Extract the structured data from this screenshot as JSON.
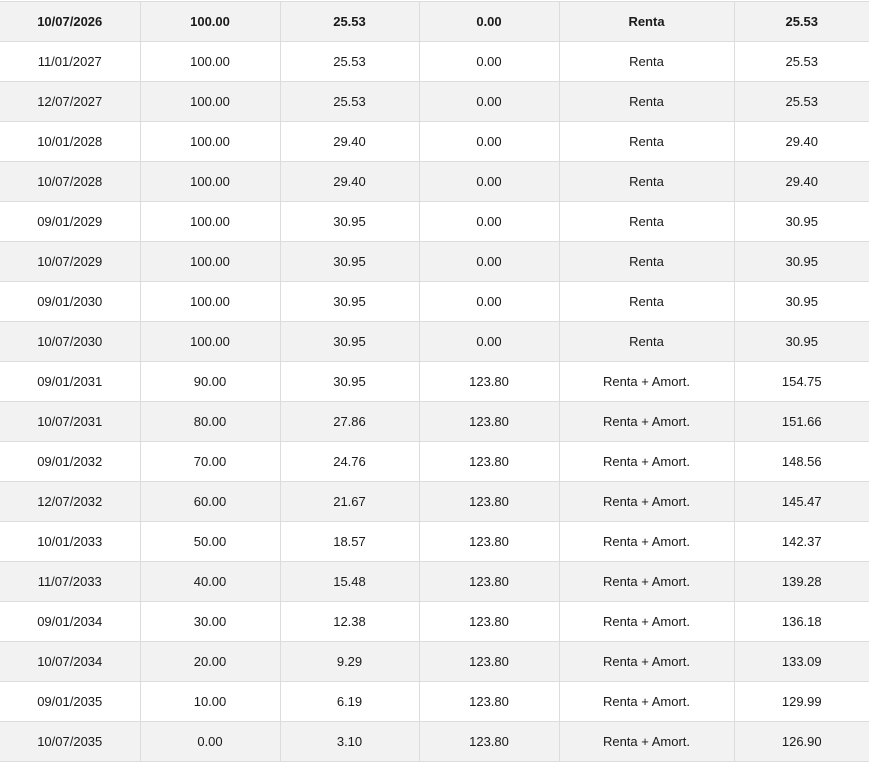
{
  "table": {
    "rows": [
      {
        "fecha": "10/07/2026",
        "valor_residual": "100.00",
        "interes": "25.53",
        "amortizacion": "0.00",
        "tipo": "Renta",
        "total": "25.53",
        "highlight": true
      },
      {
        "fecha": "11/01/2027",
        "valor_residual": "100.00",
        "interes": "25.53",
        "amortizacion": "0.00",
        "tipo": "Renta",
        "total": "25.53"
      },
      {
        "fecha": "12/07/2027",
        "valor_residual": "100.00",
        "interes": "25.53",
        "amortizacion": "0.00",
        "tipo": "Renta",
        "total": "25.53"
      },
      {
        "fecha": "10/01/2028",
        "valor_residual": "100.00",
        "interes": "29.40",
        "amortizacion": "0.00",
        "tipo": "Renta",
        "total": "29.40"
      },
      {
        "fecha": "10/07/2028",
        "valor_residual": "100.00",
        "interes": "29.40",
        "amortizacion": "0.00",
        "tipo": "Renta",
        "total": "29.40"
      },
      {
        "fecha": "09/01/2029",
        "valor_residual": "100.00",
        "interes": "30.95",
        "amortizacion": "0.00",
        "tipo": "Renta",
        "total": "30.95"
      },
      {
        "fecha": "10/07/2029",
        "valor_residual": "100.00",
        "interes": "30.95",
        "amortizacion": "0.00",
        "tipo": "Renta",
        "total": "30.95"
      },
      {
        "fecha": "09/01/2030",
        "valor_residual": "100.00",
        "interes": "30.95",
        "amortizacion": "0.00",
        "tipo": "Renta",
        "total": "30.95"
      },
      {
        "fecha": "10/07/2030",
        "valor_residual": "100.00",
        "interes": "30.95",
        "amortizacion": "0.00",
        "tipo": "Renta",
        "total": "30.95"
      },
      {
        "fecha": "09/01/2031",
        "valor_residual": "90.00",
        "interes": "30.95",
        "amortizacion": "123.80",
        "tipo": "Renta + Amort.",
        "total": "154.75"
      },
      {
        "fecha": "10/07/2031",
        "valor_residual": "80.00",
        "interes": "27.86",
        "amortizacion": "123.80",
        "tipo": "Renta + Amort.",
        "total": "151.66"
      },
      {
        "fecha": "09/01/2032",
        "valor_residual": "70.00",
        "interes": "24.76",
        "amortizacion": "123.80",
        "tipo": "Renta + Amort.",
        "total": "148.56"
      },
      {
        "fecha": "12/07/2032",
        "valor_residual": "60.00",
        "interes": "21.67",
        "amortizacion": "123.80",
        "tipo": "Renta + Amort.",
        "total": "145.47"
      },
      {
        "fecha": "10/01/2033",
        "valor_residual": "50.00",
        "interes": "18.57",
        "amortizacion": "123.80",
        "tipo": "Renta + Amort.",
        "total": "142.37"
      },
      {
        "fecha": "11/07/2033",
        "valor_residual": "40.00",
        "interes": "15.48",
        "amortizacion": "123.80",
        "tipo": "Renta + Amort.",
        "total": "139.28"
      },
      {
        "fecha": "09/01/2034",
        "valor_residual": "30.00",
        "interes": "12.38",
        "amortizacion": "123.80",
        "tipo": "Renta + Amort.",
        "total": "136.18"
      },
      {
        "fecha": "10/07/2034",
        "valor_residual": "20.00",
        "interes": "9.29",
        "amortizacion": "123.80",
        "tipo": "Renta + Amort.",
        "total": "133.09"
      },
      {
        "fecha": "09/01/2035",
        "valor_residual": "10.00",
        "interes": "6.19",
        "amortizacion": "123.80",
        "tipo": "Renta + Amort.",
        "total": "129.99"
      },
      {
        "fecha": "10/07/2035",
        "valor_residual": "0.00",
        "interes": "3.10",
        "amortizacion": "123.80",
        "tipo": "Renta + Amort.",
        "total": "126.90"
      }
    ]
  }
}
